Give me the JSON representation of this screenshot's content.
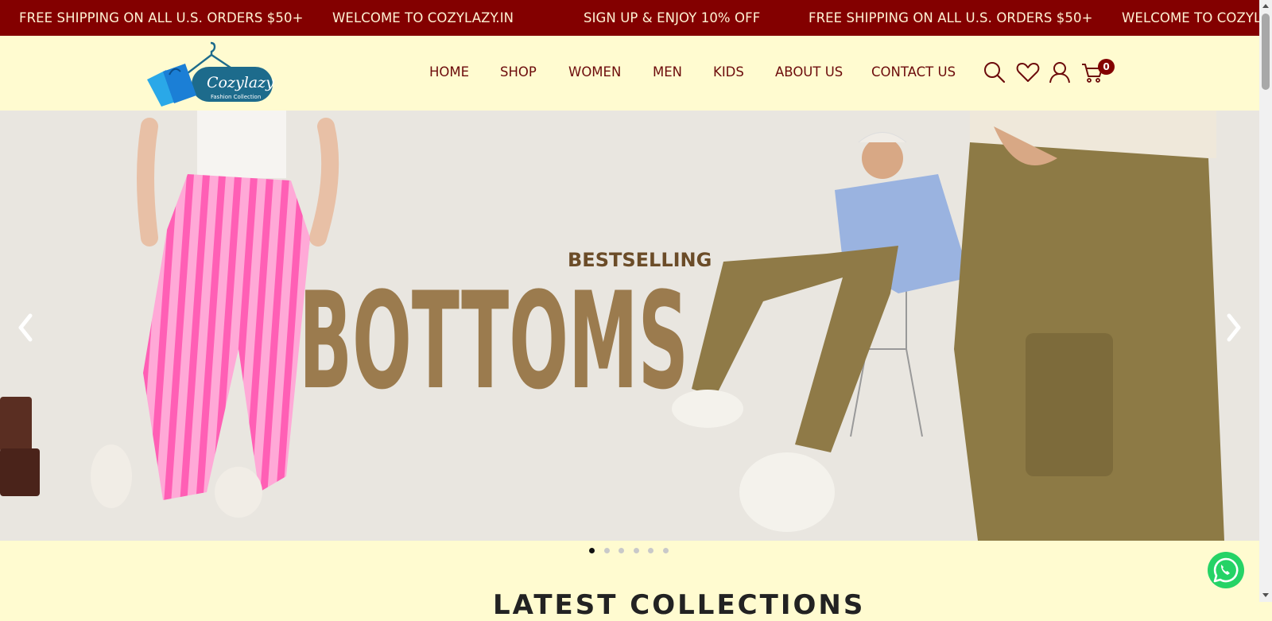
{
  "announcement": {
    "messages": [
      "FREE SHIPPING ON ALL U.S. ORDERS $50+",
      "WELCOME TO COZYLAZY.IN",
      "SIGN UP & ENJOY 10% OFF",
      "FREE SHIPPING ON ALL U.S. ORDERS $50+",
      "WELCOME TO COZYLA"
    ]
  },
  "logo": {
    "name": "Cozylazy",
    "tagline": "Fashion Collection"
  },
  "nav": {
    "items": [
      "HOME",
      "SHOP",
      "WOMEN",
      "MEN",
      "KIDS",
      "ABOUT US",
      "CONTACT US"
    ]
  },
  "header_icons": {
    "search": "search-icon",
    "wishlist": "heart-icon",
    "account": "user-icon",
    "cart": "cart-icon",
    "cart_count": "0"
  },
  "hero": {
    "slide_kicker": "BESTSELLING",
    "slide_title": "BOTTOMS",
    "prev_icon": "chevron-left-icon",
    "next_icon": "chevron-right-icon",
    "slide_count": 6,
    "active_slide": 1
  },
  "section": {
    "heading_partial": "LATEST COLLECTIONS"
  },
  "colors": {
    "brand": "#830000",
    "header_bg": "#fffbd0",
    "nav_text": "#6c0b0b",
    "hero_text": "#9b7b4e",
    "whatsapp": "#25d366"
  }
}
